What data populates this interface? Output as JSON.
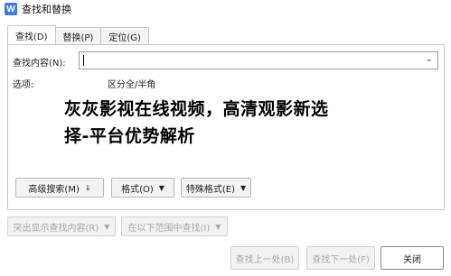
{
  "window": {
    "title": "查找和替换",
    "app_icon_letter": "W"
  },
  "tabs": [
    {
      "label": "查找(D)",
      "active": true
    },
    {
      "label": "替换(P)",
      "active": false
    },
    {
      "label": "定位(G)",
      "active": false
    }
  ],
  "find": {
    "label": "查找内容(N):",
    "value": "",
    "dropdown_icon": "chevron-down-icon"
  },
  "options": {
    "label": "选项:",
    "value": "区分全/半角"
  },
  "overlay_text": {
    "line1": "灰灰影视在线视频，高清观影新选",
    "line2": "择-平台优势解析"
  },
  "option_buttons": {
    "advanced": "高级搜索(M)",
    "advanced_icon": "chevron-double-down-icon",
    "format": "格式(O)",
    "special": "特殊格式(E)"
  },
  "highlight_buttons": {
    "highlight": "突出显示查找内容(R)",
    "find_in": "在以下范围中查找(I)"
  },
  "action_buttons": {
    "find_prev": "查找上一处(B)",
    "find_next": "查找下一处(F)",
    "close": "关闭"
  }
}
